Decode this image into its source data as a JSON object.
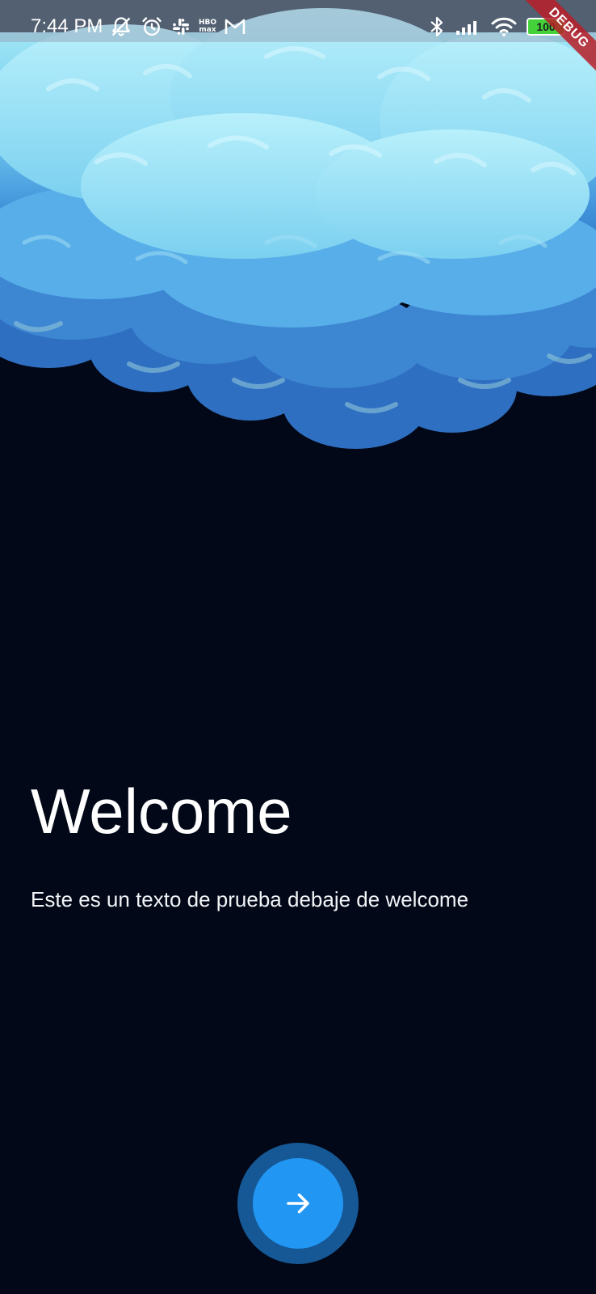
{
  "status_bar": {
    "time": "7:44 PM",
    "left_icons": [
      "notifications-off-icon",
      "alarm-icon",
      "slack-icon",
      "hbo-max-icon",
      "gmail-icon"
    ],
    "hbo_label_top": "HBO",
    "hbo_label_bottom": "max",
    "right_icons": [
      "bluetooth-icon",
      "cell-signal-icon",
      "wifi-icon",
      "battery-icon"
    ],
    "battery_level": "100",
    "battery_color": "#44d13a"
  },
  "debug_banner": {
    "label": "DEBUG"
  },
  "welcome": {
    "title": "Welcome",
    "subtitle": "Este es un texto de prueba debaje de welcome"
  },
  "next_button": {
    "icon": "arrow-right-icon",
    "color": "#2196f3",
    "ring_color": "#165896"
  },
  "theme": {
    "background": "#020817"
  }
}
